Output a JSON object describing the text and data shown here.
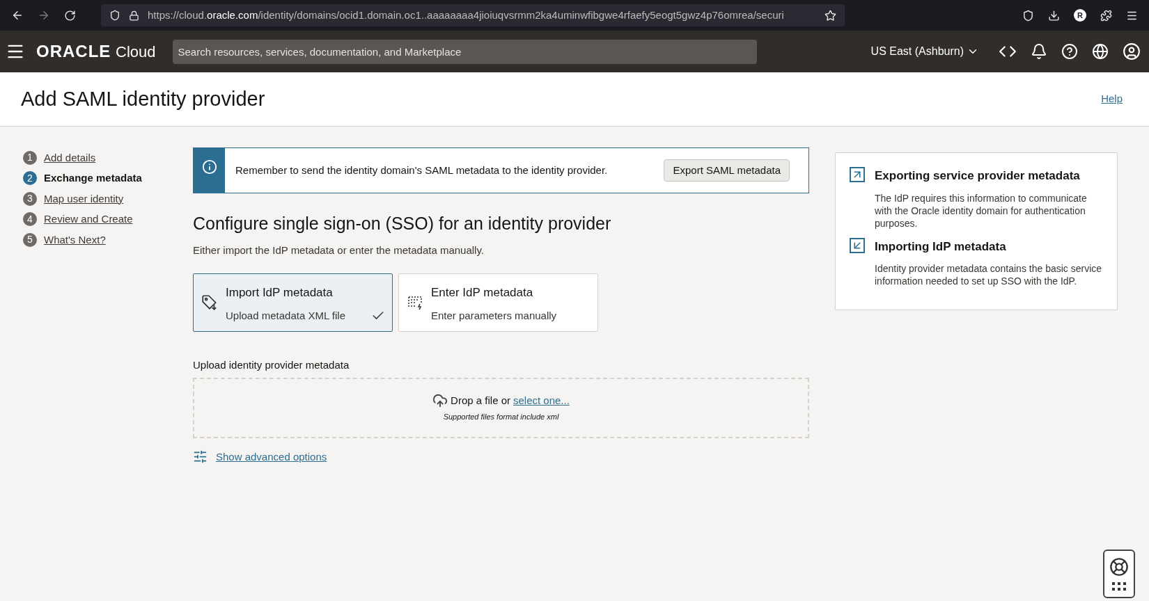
{
  "browser": {
    "url_host_prefix": "https://cloud.",
    "url_host": "oracle.com",
    "url_path": "/identity/domains/ocid1.domain.oc1..aaaaaaaa4jioiuqvsrmm2ka4uminwfibgwe4rfaefy5eogt5gwz4p76omrea/securi",
    "profile_initial": "R"
  },
  "header": {
    "logo_brand": "ORACLE",
    "logo_product": "Cloud",
    "search_placeholder": "Search resources, services, documentation, and Marketplace",
    "region": "US East (Ashburn)"
  },
  "page": {
    "title": "Add SAML identity provider",
    "help": "Help"
  },
  "steps": [
    {
      "number": "1",
      "label": "Add details",
      "selected": false
    },
    {
      "number": "2",
      "label": "Exchange metadata",
      "selected": true
    },
    {
      "number": "3",
      "label": "Map user identity",
      "selected": false
    },
    {
      "number": "4",
      "label": "Review and Create",
      "selected": false
    },
    {
      "number": "5",
      "label": "What's Next?",
      "selected": false
    }
  ],
  "banner": {
    "message": "Remember to send the identity domain's SAML metadata to the identity provider.",
    "button": "Export SAML metadata"
  },
  "section": {
    "heading": "Configure single sign-on (SSO) for an identity provider",
    "subheading": "Either import the IdP metadata or enter the metadata manually."
  },
  "options": [
    {
      "kind": "import",
      "title": "Import IdP metadata",
      "subtitle": "Upload metadata XML file",
      "selected": true
    },
    {
      "kind": "enter",
      "title": "Enter IdP metadata",
      "subtitle": "Enter parameters manually",
      "selected": false
    }
  ],
  "upload": {
    "label": "Upload identity provider metadata",
    "drop_text": "Drop a file or",
    "link": "select one...",
    "hint": "Supported files format include xml"
  },
  "advanced_link": "Show advanced options",
  "info_panel": [
    {
      "kind": "export",
      "title": "Exporting service provider metadata",
      "body": "The IdP requires this information to communicate with the Oracle identity domain for authentication purposes."
    },
    {
      "kind": "import",
      "title": "Importing IdP metadata",
      "body": "Identity provider metadata contains the basic service information needed to set up SSO with the IdP."
    }
  ]
}
